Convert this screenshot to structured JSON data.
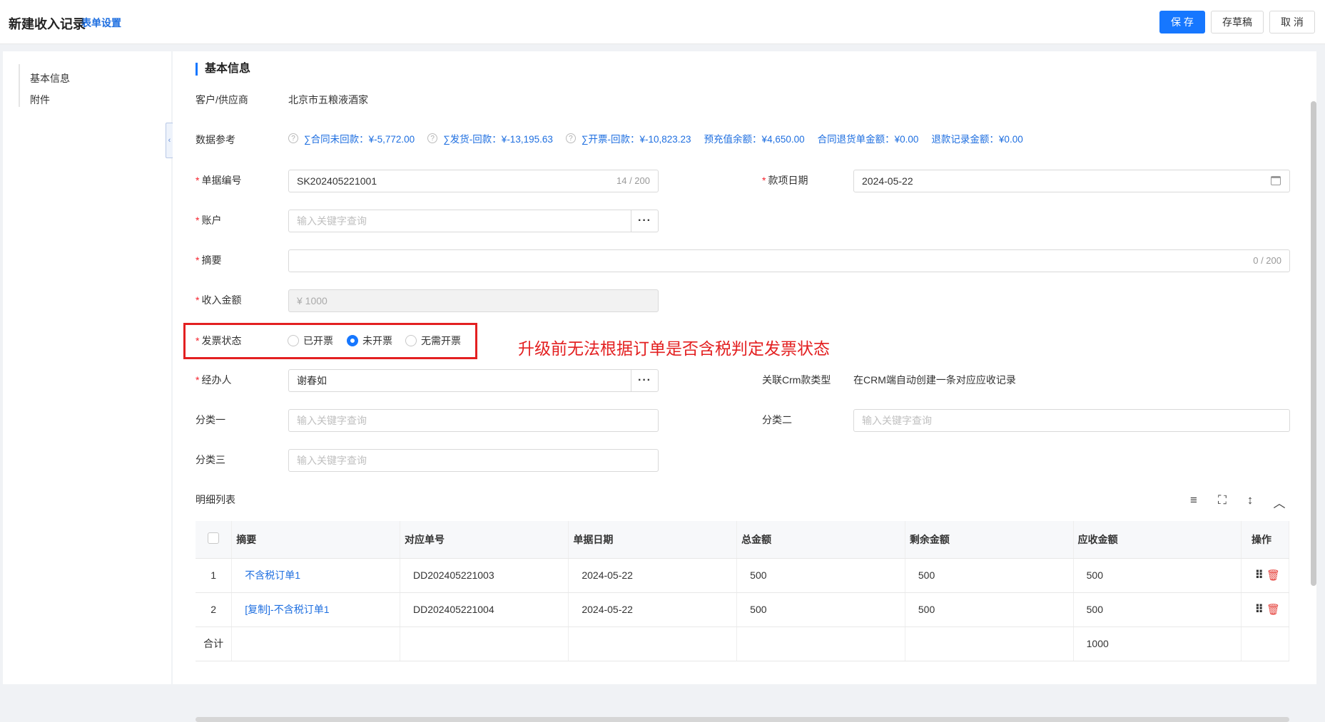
{
  "header": {
    "title": "新建收入记录",
    "form_settings": "表单设置",
    "save": "保 存",
    "draft": "存草稿",
    "cancel": "取 消"
  },
  "sidebar": {
    "items": [
      {
        "label": "基本信息"
      },
      {
        "label": "附件"
      }
    ],
    "collapse_glyph": "‹"
  },
  "section": {
    "title": "基本信息"
  },
  "form": {
    "customer": {
      "label": "客户/供应商",
      "value": "北京市五粮液酒家"
    },
    "data_ref": {
      "label": "数据参考",
      "items": [
        "∑合同未回款：¥-5,772.00",
        "∑发货-回款：¥-13,195.63",
        "∑开票-回款：¥-10,823.23",
        "预充值余额：¥4,650.00",
        "合同退货单金额：¥0.00",
        "退款记录金额：¥0.00"
      ]
    },
    "bill_no": {
      "label": "单据编号",
      "value": "SK202405221001",
      "counter": "14 / 200"
    },
    "pay_date": {
      "label": "款项日期",
      "value": "2024-05-22"
    },
    "account": {
      "label": "账户",
      "placeholder": "输入关键字查询"
    },
    "summary": {
      "label": "摘要",
      "counter": "0 / 200"
    },
    "amount": {
      "label": "收入金额",
      "value": "¥ 1000"
    },
    "invoice": {
      "label": "发票状态",
      "options": [
        "已开票",
        "未开票",
        "无需开票"
      ],
      "selected": "未开票"
    },
    "handler": {
      "label": "经办人",
      "value": "谢春如"
    },
    "crm_type": {
      "label": "关联Crm款类型",
      "value": "在CRM端自动创建一条对应应收记录"
    },
    "cat1": {
      "label": "分类一",
      "placeholder": "输入关键字查询"
    },
    "cat2": {
      "label": "分类二",
      "placeholder": "输入关键字查询"
    },
    "cat3": {
      "label": "分类三",
      "placeholder": "输入关键字查询"
    },
    "required_mark": "*",
    "ellipsis": "···"
  },
  "annotation": "升级前无法根据订单是否含税判定发票状态",
  "detail": {
    "title": "明细列表",
    "tool_icons": [
      "≡",
      "⛶",
      "↕",
      "︿"
    ],
    "columns": [
      "摘要",
      "对应单号",
      "单据日期",
      "总金额",
      "剩余金额",
      "应收金额",
      "操作"
    ],
    "rows": [
      {
        "idx": "1",
        "summary": "不含税订单1",
        "order_no": "DD202405221003",
        "date": "2024-05-22",
        "total": "500",
        "remain": "500",
        "receivable": "500"
      },
      {
        "idx": "2",
        "summary": "[复制]-不含税订单1",
        "order_no": "DD202405221004",
        "date": "2024-05-22",
        "total": "500",
        "remain": "500",
        "receivable": "500"
      }
    ],
    "total_row": {
      "label": "合计",
      "receivable": "1000"
    },
    "drag_glyph": "⠿",
    "delete_glyph": "🗑"
  }
}
